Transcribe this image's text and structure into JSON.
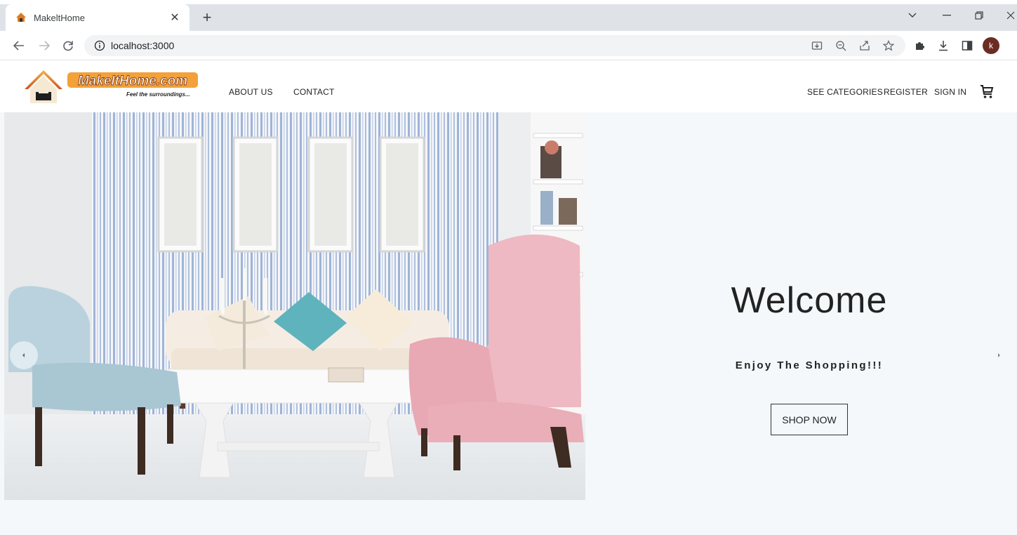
{
  "browser": {
    "tab_title": "MakeltHome",
    "url": "localhost:3000",
    "avatar_letter": "k"
  },
  "header": {
    "logo_text": "MakeItHome.com",
    "logo_tagline": "Feel the surroundings...",
    "nav_left": [
      "ABOUT US",
      "CONTACT"
    ],
    "nav_right": [
      "SEE CATEGORIES",
      "REGISTER",
      "SIGN IN"
    ]
  },
  "hero": {
    "title": "Welcome",
    "subtitle": "Enjoy The Shopping!!!",
    "cta_label": "SHOP NOW"
  },
  "colors": {
    "accent_orange": "#e07a1f",
    "hero_bg": "#f4f8fb",
    "text_dark": "#222222"
  }
}
